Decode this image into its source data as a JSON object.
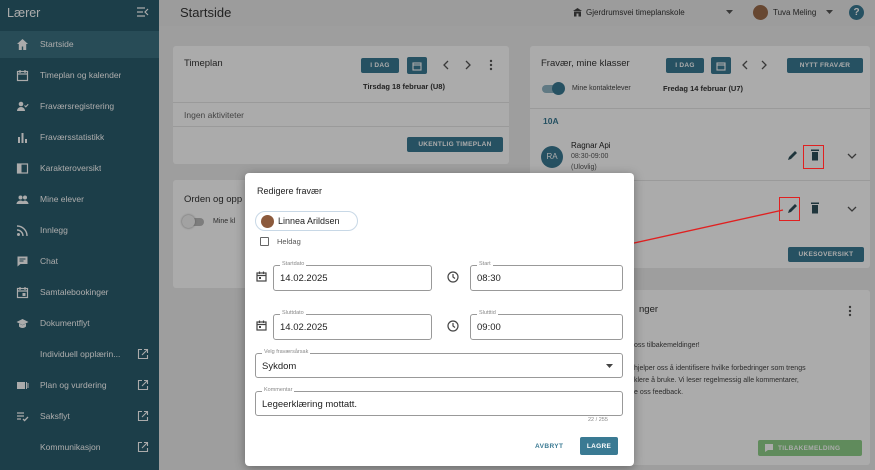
{
  "sidebar": {
    "title": "Lærer",
    "items": [
      {
        "label": "Startside",
        "icon": "home-icon"
      },
      {
        "label": "Timeplan og kalender",
        "icon": "calendar-icon"
      },
      {
        "label": "Fraværsregistrering",
        "icon": "person-check-icon"
      },
      {
        "label": "Fraværsstatistikk",
        "icon": "bar-chart-icon"
      },
      {
        "label": "Karakteroversikt",
        "icon": "book-icon"
      },
      {
        "label": "Mine elever",
        "icon": "people-icon"
      },
      {
        "label": "Innlegg",
        "icon": "rss-icon"
      },
      {
        "label": "Chat",
        "icon": "chat-icon"
      },
      {
        "label": "Samtalebookinger",
        "icon": "calendar-check-icon"
      },
      {
        "label": "Dokumentflyt",
        "icon": "graduation-cap-icon"
      },
      {
        "label": "Individuell opplærin...",
        "icon": "external-link-icon"
      },
      {
        "label": "Plan og vurdering",
        "icon": "external-link-icon"
      },
      {
        "label": "Saksflyt",
        "icon": "external-link-icon"
      },
      {
        "label": "Kommunikasjon",
        "icon": "external-link-icon"
      }
    ]
  },
  "topbar": {
    "page_title": "Startside",
    "school": "Gjerdrumsvei timeplanskole",
    "user": "Tuva Meling"
  },
  "timeplan": {
    "title": "Timeplan",
    "today_label": "I DAG",
    "date": "Tirsdag 18 februar (U8)",
    "no_activities": "Ingen aktiviteter",
    "weekly_button": "UKENTLIG TIMEPLAN"
  },
  "order_card": {
    "title": "Orden og opp",
    "toggle_label": "Mine kl"
  },
  "absence": {
    "title": "Fravær, mine klasser",
    "today_label": "I DAG",
    "new_button": "NYTT FRAVÆR",
    "toggle_label": "Mine kontaktelever",
    "date": "Fredag 14 februar (U7)",
    "class": "10A",
    "entry_initials": "RA",
    "entry_name": "Ragnar Api",
    "entry_time": "08:30-09:00",
    "entry_note": "(Ulovlig)",
    "week_button": "UKESOVERSIKT"
  },
  "feedback": {
    "title": "nger",
    "line1": "oss tilbakemeldinger!",
    "line2": "hjelper oss å identifisere hvilke forbedringer som trengs",
    "line3": "klere å bruke. Vi leser regelmessig alle kommentarer,",
    "line4": "e oss feedback.",
    "button": "TILBAKEMELDING"
  },
  "dialog": {
    "title": "Redigere fravær",
    "student": "Linnea Arildsen",
    "allday_label": "Heldag",
    "start_date_label": "Startdato",
    "start_date": "14.02.2025",
    "start_time_label": "Start",
    "start_time": "08:30",
    "end_date_label": "Sluttdato",
    "end_date": "14.02.2025",
    "end_time_label": "Slutttid",
    "end_time": "09:00",
    "reason_label": "Velg fraværsårsak",
    "reason": "Sykdom",
    "comment_label": "Kommentar",
    "comment": "Legeerklæring mottatt.",
    "counter": "22 / 255",
    "cancel": "AVBRYT",
    "save": "LAGRE"
  },
  "colors": {
    "sidebar": "#2a5d6d",
    "accent": "#3a7a93",
    "highlight": "#e02020"
  }
}
